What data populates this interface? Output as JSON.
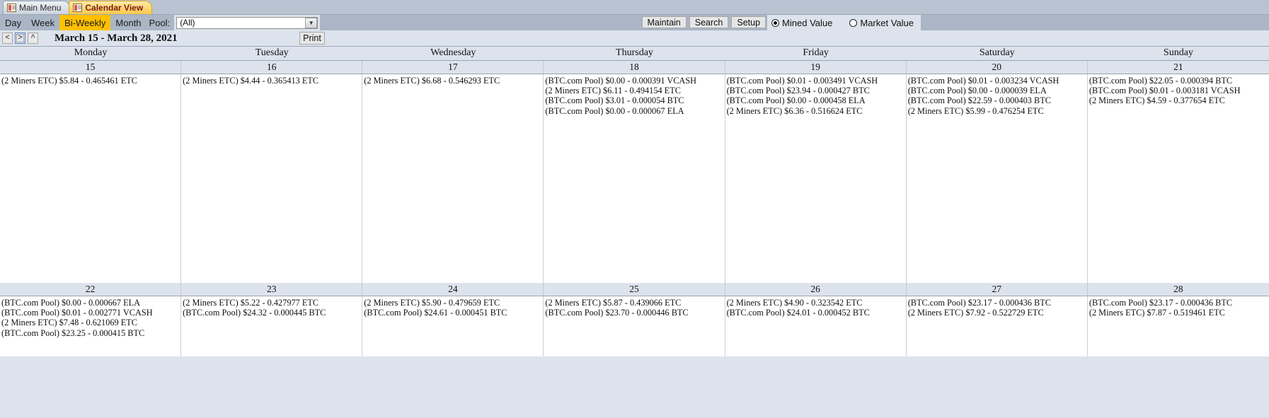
{
  "window": {
    "tabs": [
      {
        "label": "Main Menu",
        "active": false,
        "icon": "form-icon"
      },
      {
        "label": "Calendar View",
        "active": true,
        "icon": "form-icon"
      }
    ]
  },
  "toolbar": {
    "views": [
      {
        "label": "Day",
        "selected": false
      },
      {
        "label": "Week",
        "selected": false
      },
      {
        "label": "Bi-Weekly",
        "selected": true
      },
      {
        "label": "Month",
        "selected": false
      }
    ],
    "pool_label": "Pool:",
    "pool_value": "(All)",
    "pool_dropdown_icon": "chevron-down-icon",
    "buttons": [
      {
        "label": "Maintain"
      },
      {
        "label": "Search"
      },
      {
        "label": "Setup"
      }
    ],
    "radios": [
      {
        "label": "Mined Value",
        "selected": true
      },
      {
        "label": "Market Value",
        "selected": false
      }
    ],
    "accent_selected_color": "#ffc000",
    "toolbar_background": "#aab6c6"
  },
  "nav": {
    "prev_label": "<",
    "next_label": ">",
    "up_label": "^",
    "date_range": "March 15 - March 28, 2021",
    "print_label": "Print"
  },
  "calendar": {
    "day_names": [
      "Monday",
      "Tuesday",
      "Wednesday",
      "Thursday",
      "Friday",
      "Saturday",
      "Sunday"
    ],
    "weeks": [
      {
        "day_numbers": [
          "15",
          "16",
          "17",
          "18",
          "19",
          "20",
          "21"
        ],
        "cells": [
          [
            "(2 Miners ETC) $5.84 - 0.465461 ETC"
          ],
          [
            "(2 Miners ETC) $4.44 - 0.365413 ETC"
          ],
          [
            "(2 Miners ETC) $6.68 - 0.546293 ETC"
          ],
          [
            "(BTC.com Pool) $0.00 - 0.000391 VCASH",
            "(2 Miners ETC) $6.11 - 0.494154 ETC",
            "(BTC.com Pool) $3.01 - 0.000054 BTC",
            "(BTC.com Pool) $0.00 - 0.000067 ELA"
          ],
          [
            "(BTC.com Pool) $0.01 - 0.003491 VCASH",
            "(BTC.com Pool) $23.94 - 0.000427 BTC",
            "(BTC.com Pool) $0.00 - 0.000458 ELA",
            "(2 Miners ETC) $6.36 - 0.516624 ETC"
          ],
          [
            "(BTC.com Pool) $0.01 - 0.003234 VCASH",
            "(BTC.com Pool) $0.00 - 0.000039 ELA",
            "(BTC.com Pool) $22.59 - 0.000403 BTC",
            "(2 Miners ETC) $5.99 - 0.476254 ETC"
          ],
          [
            "(BTC.com Pool) $22.05 - 0.000394 BTC",
            "(BTC.com Pool) $0.01 - 0.003181 VCASH",
            "(2 Miners ETC) $4.59 - 0.377654 ETC"
          ]
        ]
      },
      {
        "day_numbers": [
          "22",
          "23",
          "24",
          "25",
          "26",
          "27",
          "28"
        ],
        "cells": [
          [
            "(BTC.com Pool) $0.00 - 0.000667 ELA",
            "(BTC.com Pool) $0.01 - 0.002771 VCASH",
            "(2 Miners ETC) $7.48 - 0.621069 ETC",
            "(BTC.com Pool) $23.25 - 0.000415 BTC"
          ],
          [
            "(2 Miners ETC) $5.22 - 0.427977 ETC",
            "(BTC.com Pool) $24.32 - 0.000445 BTC"
          ],
          [
            "(2 Miners ETC) $5.90 - 0.479659 ETC",
            "(BTC.com Pool) $24.61 - 0.000451 BTC"
          ],
          [
            "(2 Miners ETC) $5.87 - 0.439066 ETC",
            "(BTC.com Pool) $23.70 - 0.000446 BTC"
          ],
          [
            "(2 Miners ETC) $4.90 - 0.323542 ETC",
            "(BTC.com Pool) $24.01 - 0.000452 BTC"
          ],
          [
            "(BTC.com Pool) $23.17 - 0.000436 BTC",
            "(2 Miners ETC) $7.92 - 0.522729 ETC"
          ],
          [
            "(BTC.com Pool) $23.17 - 0.000436 BTC",
            "(2 Miners ETC) $7.87 - 0.519461 ETC"
          ]
        ]
      }
    ]
  }
}
